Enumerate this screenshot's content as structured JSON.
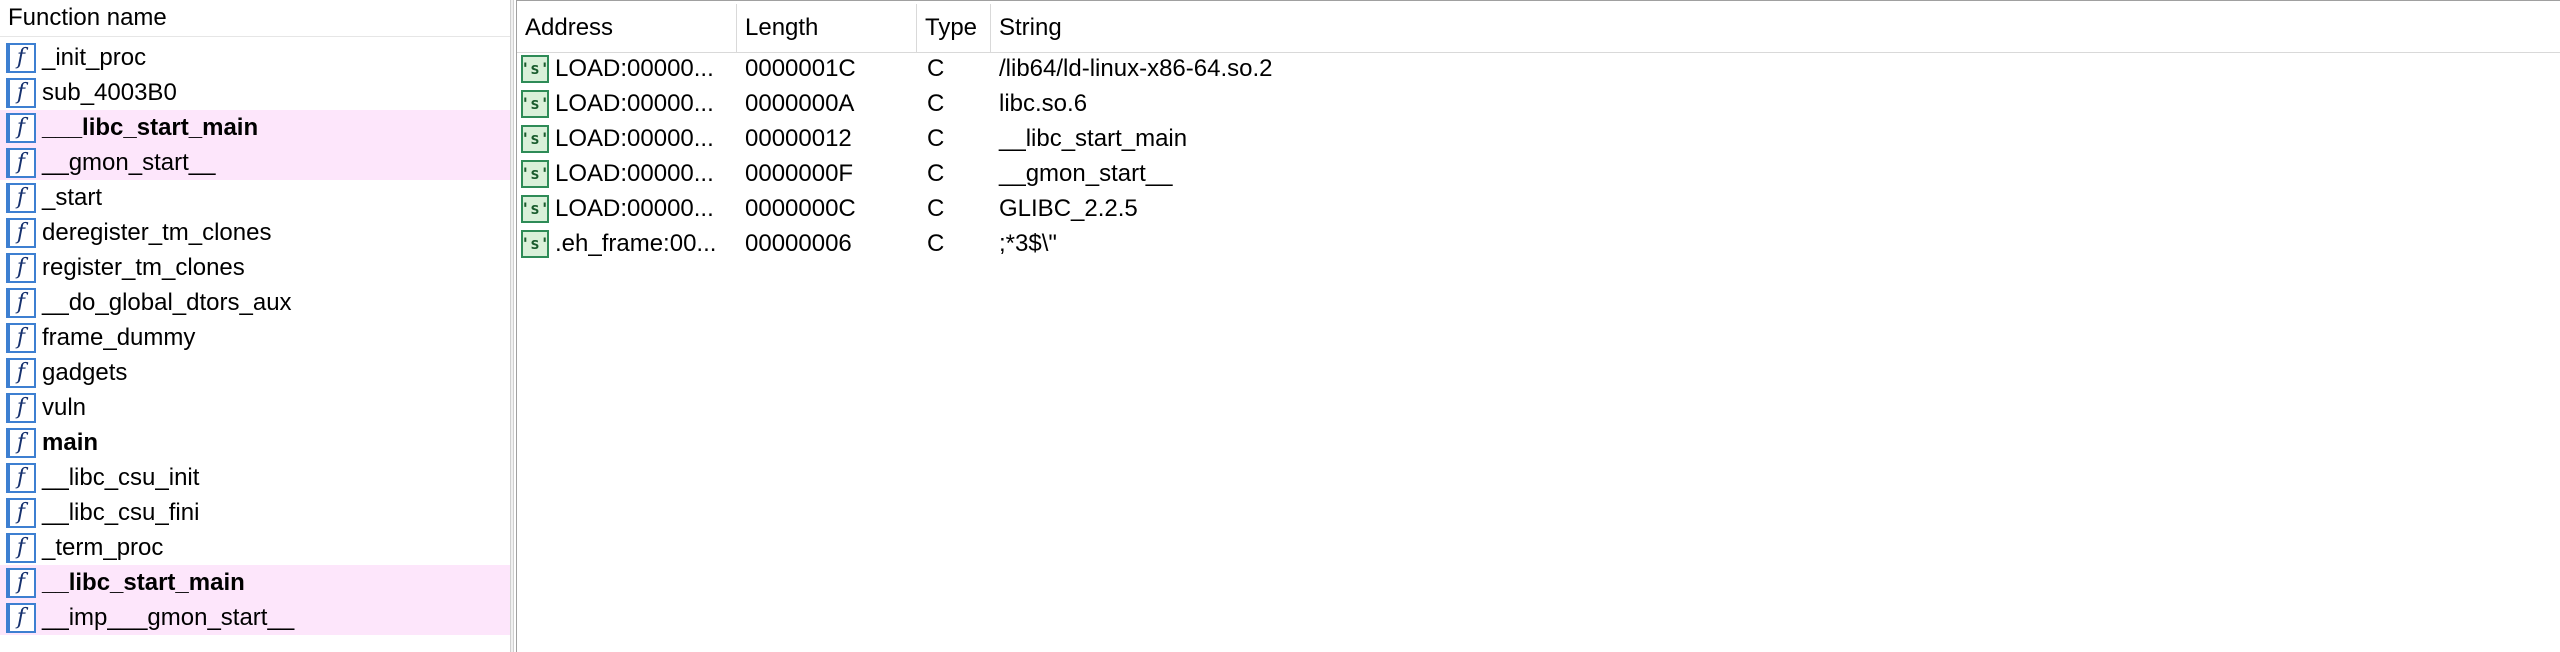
{
  "functions": {
    "header": "Function name",
    "items": [
      {
        "name": "_init_proc",
        "lib": false,
        "bold": false
      },
      {
        "name": "sub_4003B0",
        "lib": false,
        "bold": false
      },
      {
        "name": "___libc_start_main",
        "lib": true,
        "bold": true
      },
      {
        "name": "__gmon_start__",
        "lib": true,
        "bold": false
      },
      {
        "name": "_start",
        "lib": false,
        "bold": false
      },
      {
        "name": "deregister_tm_clones",
        "lib": false,
        "bold": false
      },
      {
        "name": "register_tm_clones",
        "lib": false,
        "bold": false
      },
      {
        "name": "__do_global_dtors_aux",
        "lib": false,
        "bold": false
      },
      {
        "name": "frame_dummy",
        "lib": false,
        "bold": false
      },
      {
        "name": "gadgets",
        "lib": false,
        "bold": false
      },
      {
        "name": "vuln",
        "lib": false,
        "bold": false
      },
      {
        "name": "main",
        "lib": false,
        "bold": true
      },
      {
        "name": "__libc_csu_init",
        "lib": false,
        "bold": false
      },
      {
        "name": "__libc_csu_fini",
        "lib": false,
        "bold": false
      },
      {
        "name": "_term_proc",
        "lib": false,
        "bold": false
      },
      {
        "name": "__libc_start_main",
        "lib": true,
        "bold": true
      },
      {
        "name": "__imp___gmon_start__",
        "lib": true,
        "bold": false
      }
    ]
  },
  "strings": {
    "columns": {
      "address": "Address",
      "length": "Length",
      "type": "Type",
      "string": "String"
    },
    "rows": [
      {
        "address": "LOAD:00000...",
        "length": "0000001C",
        "type": "C",
        "string": "/lib64/ld-linux-x86-64.so.2"
      },
      {
        "address": "LOAD:00000...",
        "length": "0000000A",
        "type": "C",
        "string": "libc.so.6"
      },
      {
        "address": "LOAD:00000...",
        "length": "00000012",
        "type": "C",
        "string": "__libc_start_main"
      },
      {
        "address": "LOAD:00000...",
        "length": "0000000F",
        "type": "C",
        "string": "__gmon_start__"
      },
      {
        "address": "LOAD:00000...",
        "length": "0000000C",
        "type": "C",
        "string": "GLIBC_2.2.5"
      },
      {
        "address": ".eh_frame:00...",
        "length": "00000006",
        "type": "C",
        "string": ";*3$\\\""
      }
    ]
  },
  "icons": {
    "function": "function-icon",
    "string": "string-icon"
  }
}
